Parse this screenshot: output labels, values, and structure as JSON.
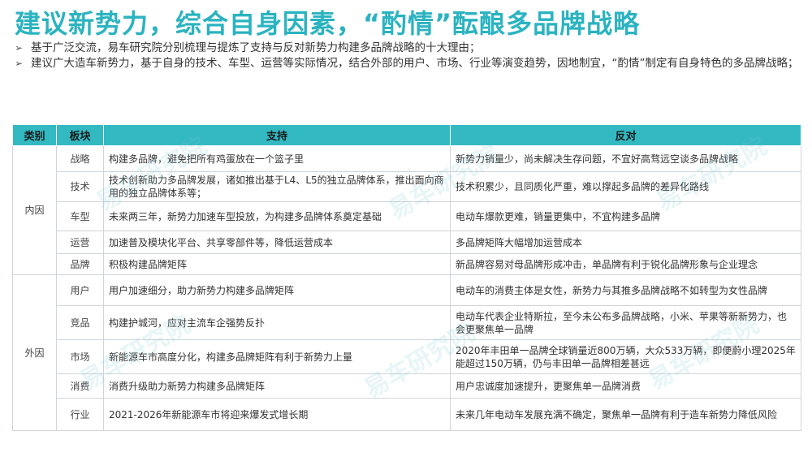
{
  "title": "建议新势力，综合自身因素，“酌情”酝酿多品牌战略",
  "bullets": [
    "基于广泛交流，易车研究院分别梳理与提炼了支持与反对新势力构建多品牌战略的十大理由；",
    "建议广大造车新势力，基于自身的技术、车型、运营等实际情况，结合外部的用户、市场、行业等演变趋势，因地制宜，“酌情”制定有自身特色的多品牌战略；"
  ],
  "table": {
    "headers": [
      "类别",
      "板块",
      "支持",
      "反对"
    ],
    "groups": [
      {
        "category": "内因",
        "rows": [
          {
            "section": "战略",
            "support": "构建多品牌，避免把所有鸡蛋放在一个篮子里",
            "oppose": "新势力销量少，尚未解决生存问题，不宜好高骛远空谈多品牌战略"
          },
          {
            "section": "技术",
            "support": "技术创新助力多品牌发展，诸如推出基于L4、L5的独立品牌体系，推出面向商用的独立品牌体系等；",
            "oppose": "技术积累少，且同质化严重，难以撑起多品牌的差异化路线"
          },
          {
            "section": "车型",
            "support": "未来两三年，新势力加速车型投放，为构建多品牌体系奠定基础",
            "oppose": "电动车爆款更难，销量更集中，不宜构建多品牌"
          },
          {
            "section": "运营",
            "support": "加速普及模块化平台、共享零部件等，降低运营成本",
            "oppose": "多品牌矩阵大幅增加运营成本"
          },
          {
            "section": "品牌",
            "support": "积极构建品牌矩阵",
            "oppose": "新品牌容易对母品牌形成冲击，单品牌有利于锐化品牌形象与企业理念"
          }
        ]
      },
      {
        "category": "外因",
        "rows": [
          {
            "section": "用户",
            "support": "用户加速细分，助力新势力构建多品牌矩阵",
            "oppose": "电动车的消费主体是女性，新势力与其推多品牌战略不如转型为女性品牌"
          },
          {
            "section": "竞品",
            "support": "构建护城河，应对主流车企强势反扑",
            "oppose": "电动车代表企业特斯拉，至今未公布多品牌战略，小米、苹果等新新势力，也会更聚焦单一品牌"
          },
          {
            "section": "市场",
            "support": "新能源车市高度分化，构建多品牌矩阵有利于新势力上量",
            "oppose": "2020年丰田单一品牌全球销量近800万辆，大众533万辆，即便蔚小理2025年能超过150万辆，仍与丰田单一品牌相差甚远"
          },
          {
            "section": "消费",
            "support": "消费升级助力新势力构建多品牌矩阵",
            "oppose": "用户忠诚度加速提升，更聚焦单一品牌消费"
          },
          {
            "section": "行业",
            "support": "2021-2026年新能源车市将迎来爆发式增长期",
            "oppose": "未来几年电动车发展充满不确定，聚焦单一品牌有利于造车新势力降低风险"
          }
        ]
      }
    ]
  },
  "watermark": "易车研究院",
  "colors": {
    "title": "#2bb3c0",
    "header_bg": "#33b9c2",
    "border": "#cfd5da"
  }
}
